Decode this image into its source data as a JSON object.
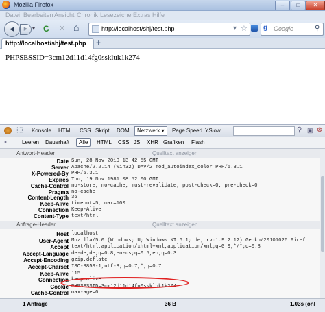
{
  "window": {
    "title": "Mozilla Firefox",
    "min": "–",
    "max": "□",
    "close": "✕"
  },
  "menu": [
    "Datei",
    "Bearbeiten",
    "Ansicht",
    "Chronik",
    "Lesezeichen",
    "Extras",
    "Hilfe"
  ],
  "nav": {
    "back": "◀",
    "forward": "▶",
    "dropdown": "▾",
    "reload": "C",
    "stop": "✕",
    "home": "⌂",
    "url": "http://localhost/shj/test.php",
    "search_placeholder": "Google",
    "star": "☆"
  },
  "tab": {
    "label": "http://localhost/shj/test.php"
  },
  "page": {
    "text": "PHPSESSID=3cm12d11d14fg0sskluk1k274"
  },
  "firebug": {
    "tabs": [
      "Konsole",
      "HTML",
      "CSS",
      "Skript",
      "DOM",
      "Netzwerk ▾",
      "Page Speed",
      "YSlow"
    ],
    "subtabs": [
      "Leeren",
      "Dauerhaft",
      "Alle",
      "HTML",
      "CSS",
      "JS",
      "XHR",
      "Grafiken",
      "Flash"
    ],
    "response_header_title": "Antwort-Header",
    "request_header_title": "Anfrage-Header",
    "source_link": "Quelltext anzeigen",
    "response_headers": [
      {
        "k": "Date",
        "v": "Sun, 28 Nov 2010 13:42:55 GMT"
      },
      {
        "k": "Server",
        "v": "Apache/2.2.14 (Win32) DAV/2 mod_autoindex_color PHP/5.3.1"
      },
      {
        "k": "X-Powered-By",
        "v": "PHP/5.3.1"
      },
      {
        "k": "Expires",
        "v": "Thu, 19 Nov 1981 08:52:00 GMT"
      },
      {
        "k": "Cache-Control",
        "v": "no-store, no-cache, must-revalidate, post-check=0, pre-check=0"
      },
      {
        "k": "Pragma",
        "v": "no-cache"
      },
      {
        "k": "Content-Length",
        "v": "36"
      },
      {
        "k": "Keep-Alive",
        "v": "timeout=5, max=100"
      },
      {
        "k": "Connection",
        "v": "Keep-Alive"
      },
      {
        "k": "Content-Type",
        "v": "text/html"
      }
    ],
    "request_headers": [
      {
        "k": "Host",
        "v": "localhost"
      },
      {
        "k": "User-Agent",
        "v": "Mozilla/5.0 (Windows; U; Windows NT 6.1; de; rv:1.9.2.12) Gecko/20101026 Firef"
      },
      {
        "k": "Accept",
        "v": "text/html,application/xhtml+xml,application/xml;q=0.9,*/*;q=0.8"
      },
      {
        "k": "Accept-Language",
        "v": "de-de,de;q=0.8,en-us;q=0.5,en;q=0.3"
      },
      {
        "k": "Accept-Encoding",
        "v": "gzip,deflate"
      },
      {
        "k": "Accept-Charset",
        "v": "ISO-8859-1,utf-8;q=0.7,*;q=0.7"
      },
      {
        "k": "Keep-Alive",
        "v": "115"
      },
      {
        "k": "Connection",
        "v": "keep-alive"
      },
      {
        "k": "Cookie",
        "v": "PHPSESSID=3cm12d11d14fg0sskluk1k274"
      },
      {
        "k": "Cache-Control",
        "v": "max-age=0"
      }
    ]
  },
  "status": {
    "requests": "1 Anfrage",
    "size": "36 B",
    "time": "1.03s (onl"
  }
}
